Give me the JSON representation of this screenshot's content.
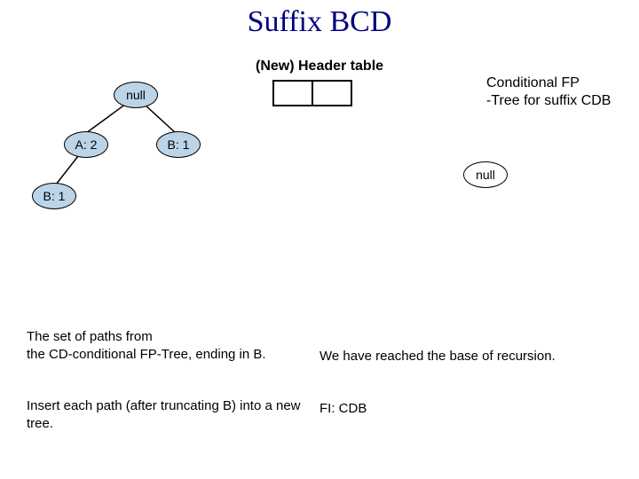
{
  "title": "Suffix BCD",
  "header_table_label": "(New) Header table",
  "conditional_label": "Conditional FP\n-Tree for suffix CDB",
  "left_tree": {
    "root": "null",
    "a": "A: 2",
    "b_right": "B: 1",
    "b_left": "B: 1"
  },
  "right_tree": {
    "root": "null"
  },
  "left_text": "The set of paths from\nthe CD-conditional FP-Tree, ending in B.\n\nInsert each path (after truncating B) into a new tree.",
  "right_text": "We have reached the base of recursion.\n\nFI: CDB"
}
